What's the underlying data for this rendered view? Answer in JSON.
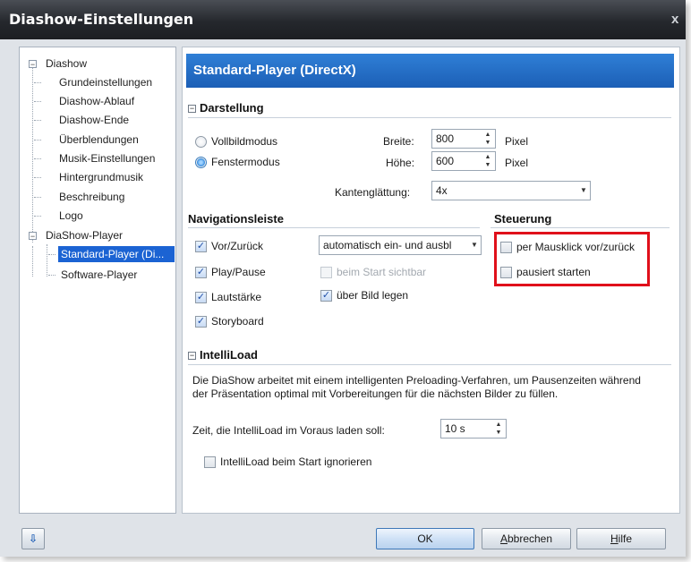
{
  "window": {
    "title": "Diashow-Einstellungen",
    "close_glyph": "x"
  },
  "tree": {
    "items": [
      {
        "label": "Diashow",
        "expander": "−"
      },
      {
        "label": "Grundeinstellungen"
      },
      {
        "label": "Diashow-Ablauf"
      },
      {
        "label": "Diashow-Ende"
      },
      {
        "label": "Überblendungen"
      },
      {
        "label": "Musik-Einstellungen"
      },
      {
        "label": "Hintergrundmusik"
      },
      {
        "label": "Beschreibung"
      },
      {
        "label": "Logo"
      },
      {
        "label": "DiaShow-Player",
        "expander": "−"
      },
      {
        "label": "Standard-Player (Di..."
      },
      {
        "label": "Software-Player"
      }
    ],
    "selected_index": 10
  },
  "main": {
    "header": "Standard-Player (DirectX)",
    "darstellung": {
      "title": "Darstellung",
      "collapse_glyph": "−",
      "vollbild_label": "Vollbildmodus",
      "fenster_label": "Fenstermodus",
      "selected_mode": "Fenstermodus",
      "breite_label": "Breite:",
      "breite_value": "800",
      "breite_unit": "Pixel",
      "hoehe_label": "Höhe:",
      "hoehe_value": "600",
      "hoehe_unit": "Pixel",
      "kanten_label": "Kantenglättung:",
      "kanten_value": "4x"
    },
    "navigation": {
      "title": "Navigationsleiste",
      "vor_label": "Vor/Zurück",
      "vor_checked": true,
      "vor_mode": "automatisch ein- und ausbl",
      "play_label": "Play/Pause",
      "play_checked": true,
      "start_visible_label": "beim Start sichtbar",
      "start_visible_checked": false,
      "lautstaerke_label": "Lautstärke",
      "lautstaerke_checked": true,
      "ueber_bild_label": "über Bild legen",
      "ueber_bild_checked": true,
      "storyboard_label": "Storyboard",
      "storyboard_checked": true
    },
    "steuerung": {
      "title": "Steuerung",
      "mausklick_label": "per Mausklick vor/zurück",
      "mausklick_checked": false,
      "pausiert_label": "pausiert starten",
      "pausiert_checked": false,
      "highlight_color": "#e0101b"
    },
    "intelliload": {
      "title": "IntelliLoad",
      "collapse_glyph": "−",
      "description_line1": "Die DiaShow arbeitet mit einem intelligenten Preloading-Verfahren, um Pausenzeiten während",
      "description_line2": "der Präsentation optimal mit Vorbereitungen für die nächsten Bilder zu füllen.",
      "zeit_label": "Zeit, die IntelliLoad im Voraus laden soll:",
      "zeit_value": "10 s",
      "ignore_label": "IntelliLoad beim Start ignorieren",
      "ignore_checked": false
    }
  },
  "footer": {
    "info_icon": "arrow-down-icon",
    "ok_label": "OK",
    "abbrechen_label": "Abbrechen",
    "abbrechen_mnemonic": "A",
    "abbrechen_rest": "bbrechen",
    "hilfe_label": "Hilfe",
    "hilfe_mnemonic": "H",
    "hilfe_rest": "ilfe"
  },
  "colors": {
    "header_blue": "#1c5fb6",
    "selection_blue": "#1b63d3",
    "titlebar": "#25282d"
  }
}
